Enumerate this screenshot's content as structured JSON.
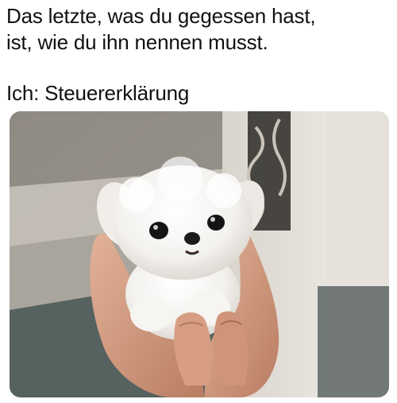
{
  "caption": {
    "line1": "Das letzte, was du gegessen hast,",
    "line2": "ist, wie du ihn nennen musst.",
    "line3": "Ich: Steuererklärung"
  },
  "photo": {
    "subject": "puppy-in-hands",
    "colors": {
      "fur": "#f5f3f0",
      "skin": "#d9a58a",
      "stairs": "#b8b3ab",
      "wall": "#e8e4de",
      "floor": "#4a5a5a"
    }
  }
}
